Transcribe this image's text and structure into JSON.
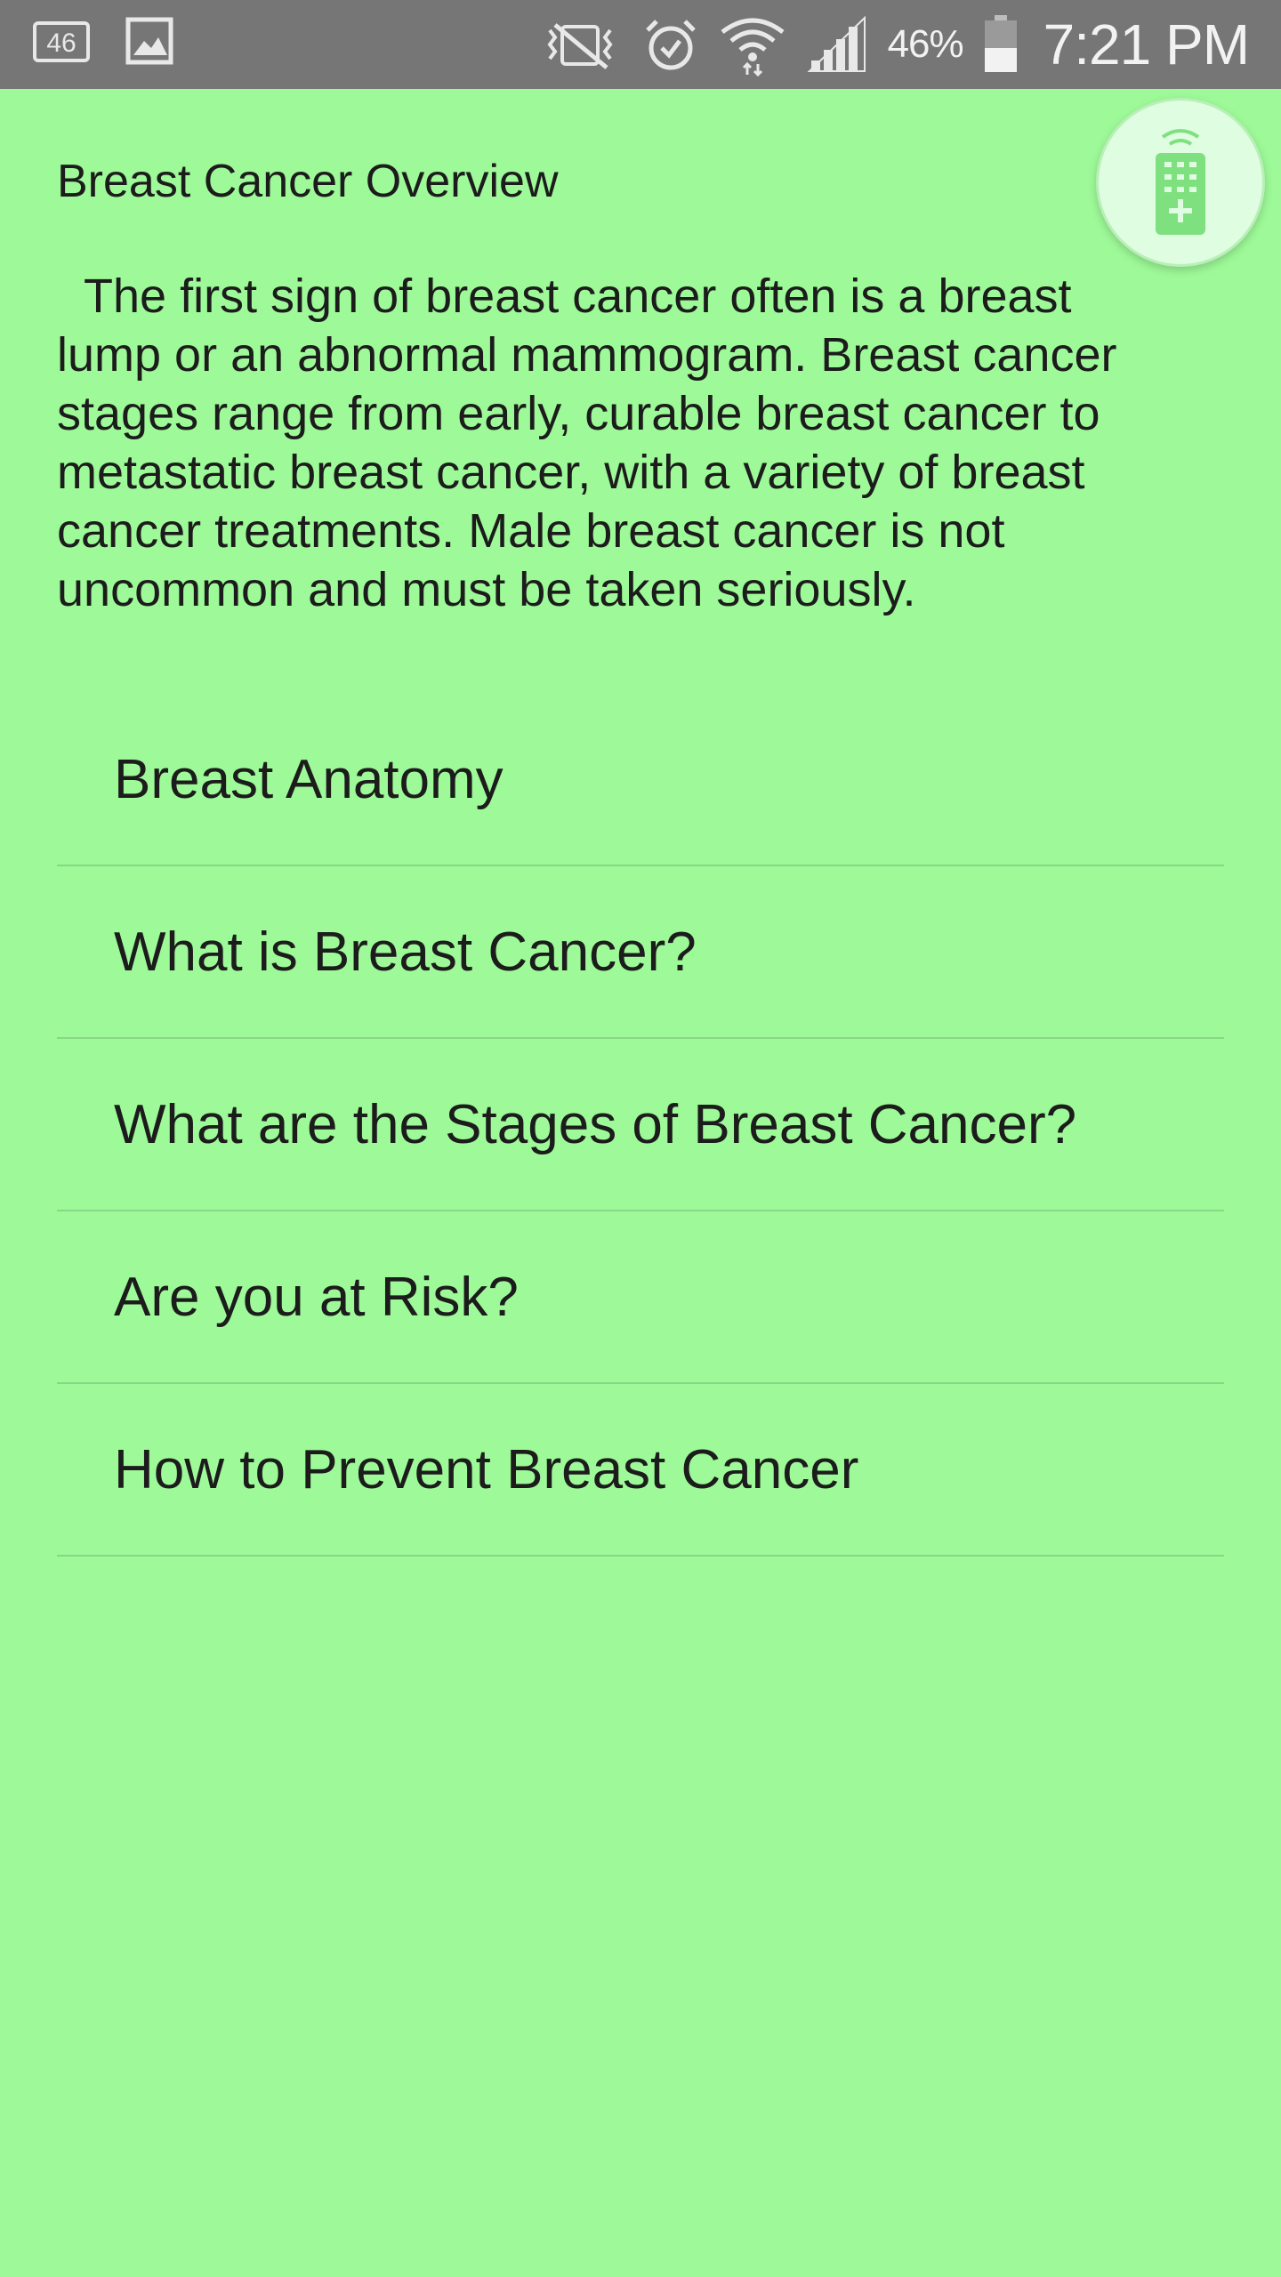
{
  "status_bar": {
    "left_icons": [
      "lte-46-icon",
      "gallery-image-icon"
    ],
    "right_icons": [
      "vibrate-mute-icon",
      "alarm-icon",
      "wifi-icon",
      "signal-icon"
    ],
    "battery_percent": "46%",
    "battery_level": 0.46,
    "time": "7:21 PM"
  },
  "header": {
    "title": "Breast Cancer Overview",
    "remote_icon": "remote-control-icon"
  },
  "overview": {
    "text": "  The first sign of breast cancer often is a breast lump or an abnormal mammogram. Breast cancer stages range from early, curable breast cancer to metastatic breast cancer, with a variety of breast cancer treatments. Male breast cancer is not uncommon and must be taken seriously."
  },
  "menu": {
    "items": [
      {
        "label": "Breast Anatomy"
      },
      {
        "label": "What is Breast Cancer?"
      },
      {
        "label": "What are the Stages of Breast Cancer?"
      },
      {
        "label": "Are you at Risk?"
      },
      {
        "label": "How to Prevent Breast Cancer"
      }
    ]
  },
  "colors": {
    "background": "#9efa98",
    "status_bar": "#767676",
    "divider": "#86d886",
    "fab": "#dffde0",
    "fab_icon": "#7fe07f"
  }
}
